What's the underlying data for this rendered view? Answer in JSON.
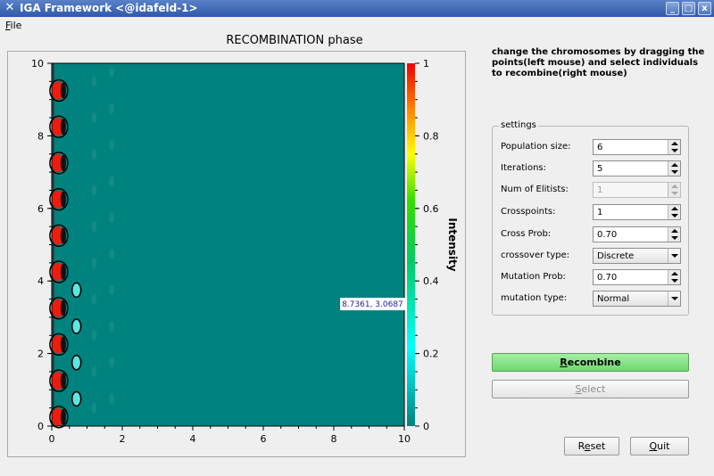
{
  "window": {
    "title": "IGA Framework <@idafeld-1>",
    "minimize_glyph": "_",
    "maximize_glyph": "□",
    "close_glyph": "x"
  },
  "menubar": {
    "file_first": "F",
    "file_rest": "ile"
  },
  "plot": {
    "title": "RECOMBINATION phase",
    "tooltip": "8.7361, 3.0687",
    "colorbar_label": "Intensity",
    "colors": {
      "field": "#00827f",
      "red": "#ee1b0f",
      "contour": "#000000"
    }
  },
  "chart_data": {
    "type": "heatmap",
    "title": "RECOMBINATION phase",
    "xlim": [
      0,
      10
    ],
    "ylim": [
      0,
      10
    ],
    "x_ticks": [
      "0",
      "2",
      "4",
      "6",
      "8",
      "10"
    ],
    "y_ticks": [
      "0",
      "2",
      "4",
      "6",
      "8",
      "10"
    ],
    "colorbar": {
      "label": "Intensity",
      "range": [
        0,
        1
      ],
      "ticks": [
        "0",
        "0.2",
        "0.4",
        "0.6",
        "0.8",
        "1"
      ]
    },
    "points": [
      {
        "x": 0.2,
        "y": 0.25,
        "intensity": 1
      },
      {
        "x": 0.2,
        "y": 1.25,
        "intensity": 1
      },
      {
        "x": 0.2,
        "y": 2.25,
        "intensity": 1
      },
      {
        "x": 0.2,
        "y": 3.25,
        "intensity": 1
      },
      {
        "x": 0.2,
        "y": 4.25,
        "intensity": 1
      },
      {
        "x": 0.2,
        "y": 5.25,
        "intensity": 1
      },
      {
        "x": 0.2,
        "y": 6.25,
        "intensity": 1
      },
      {
        "x": 0.2,
        "y": 7.25,
        "intensity": 1
      },
      {
        "x": 0.2,
        "y": 8.25,
        "intensity": 1
      },
      {
        "x": 0.2,
        "y": 9.25,
        "intensity": 1
      },
      {
        "x": 0.7,
        "y": 0.75,
        "intensity": 0.3
      },
      {
        "x": 0.7,
        "y": 1.75,
        "intensity": 0.3
      },
      {
        "x": 0.7,
        "y": 2.75,
        "intensity": 0.25
      },
      {
        "x": 0.7,
        "y": 3.75,
        "intensity": 0.2
      }
    ],
    "cursor": {
      "x": 8.7361,
      "y": 3.0687
    }
  },
  "instructions": "change the chromosomes by dragging the points(left mouse) and select individuals to recombine(right mouse)",
  "settings": {
    "title": "settings",
    "population_size": {
      "label": "Population size:",
      "value": "6"
    },
    "iterations": {
      "label": "Iterations:",
      "value": "5"
    },
    "num_elitists": {
      "label": "Num of Elitists:",
      "value": "1"
    },
    "crosspoints": {
      "label": "Crosspoints:",
      "value": "1"
    },
    "cross_prob": {
      "label": "Cross Prob:",
      "value": "0.70"
    },
    "crossover_type": {
      "label": "crossover type:",
      "value": "Discrete"
    },
    "mutation_prob": {
      "label": "Mutation Prob:",
      "value": "0.70"
    },
    "mutation_type": {
      "label": "mutation type:",
      "value": "Normal"
    }
  },
  "buttons": {
    "recombine_first": "R",
    "recombine_rest": "ecombine",
    "select_first": "S",
    "select_rest": "elect",
    "reset_pre": "R",
    "reset_u": "e",
    "reset_post": "set",
    "quit_first": "Q",
    "quit_rest": "uit"
  }
}
